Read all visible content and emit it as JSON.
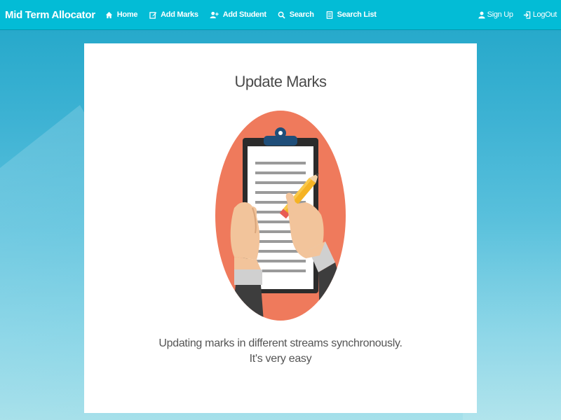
{
  "navbar": {
    "brand": "Mid Term Allocator",
    "links": [
      {
        "label": "Home",
        "icon": "home-icon"
      },
      {
        "label": "Add Marks",
        "icon": "edit-icon"
      },
      {
        "label": "Add Student",
        "icon": "add-user-icon"
      },
      {
        "label": "Search",
        "icon": "search-icon"
      },
      {
        "label": "Search List",
        "icon": "list-icon"
      }
    ],
    "right_links": [
      {
        "label": "Sign Up",
        "icon": "user-icon"
      },
      {
        "label": "LogOut",
        "icon": "logout-icon"
      }
    ],
    "color": "#03bcd6"
  },
  "card": {
    "title": "Update Marks",
    "description_line1": "Updating marks in different streams synchronously.",
    "description_line2": "It's very easy",
    "illustration": "clipboard-pencil-illustration"
  },
  "colors": {
    "accent": "#03bcd6",
    "illustration_circle": "#ef7a5c",
    "clipboard_clip": "#1f4e79",
    "pencil": "#f5b324"
  }
}
